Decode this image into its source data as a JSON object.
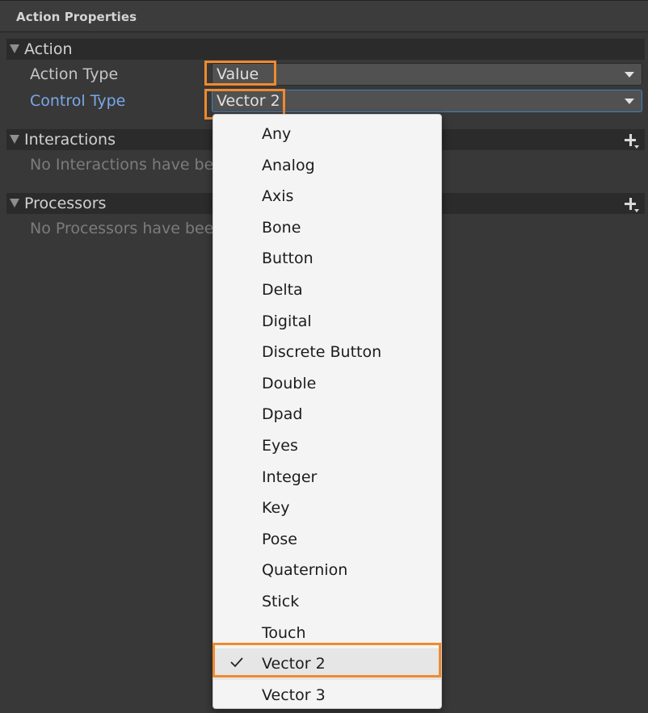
{
  "panel": {
    "title": "Action Properties"
  },
  "action_section": {
    "label": "Action",
    "action_type": {
      "label": "Action Type",
      "value": "Value"
    },
    "control_type": {
      "label": "Control Type",
      "value": "Vector 2"
    }
  },
  "interactions_section": {
    "label": "Interactions",
    "empty_text": "No Interactions have be"
  },
  "processors_section": {
    "label": "Processors",
    "empty_text": "No Processors have bee"
  },
  "control_type_menu": {
    "selected": "Vector 2",
    "items": [
      {
        "label": "Any"
      },
      {
        "label": "Analog"
      },
      {
        "label": "Axis"
      },
      {
        "label": "Bone"
      },
      {
        "label": "Button"
      },
      {
        "label": "Delta"
      },
      {
        "label": "Digital"
      },
      {
        "label": "Discrete Button"
      },
      {
        "label": "Double"
      },
      {
        "label": "Dpad"
      },
      {
        "label": "Eyes"
      },
      {
        "label": "Integer"
      },
      {
        "label": "Key"
      },
      {
        "label": "Pose"
      },
      {
        "label": "Quaternion"
      },
      {
        "label": "Stick"
      },
      {
        "label": "Touch"
      },
      {
        "label": "Vector 2"
      },
      {
        "label": "Vector 3"
      }
    ]
  },
  "colors": {
    "panel_bg": "#383838",
    "header_bg": "#2b2b2b",
    "active_label": "#7aa8e8",
    "highlight": "#f08a2e",
    "menu_bg": "#f4f4f4"
  }
}
